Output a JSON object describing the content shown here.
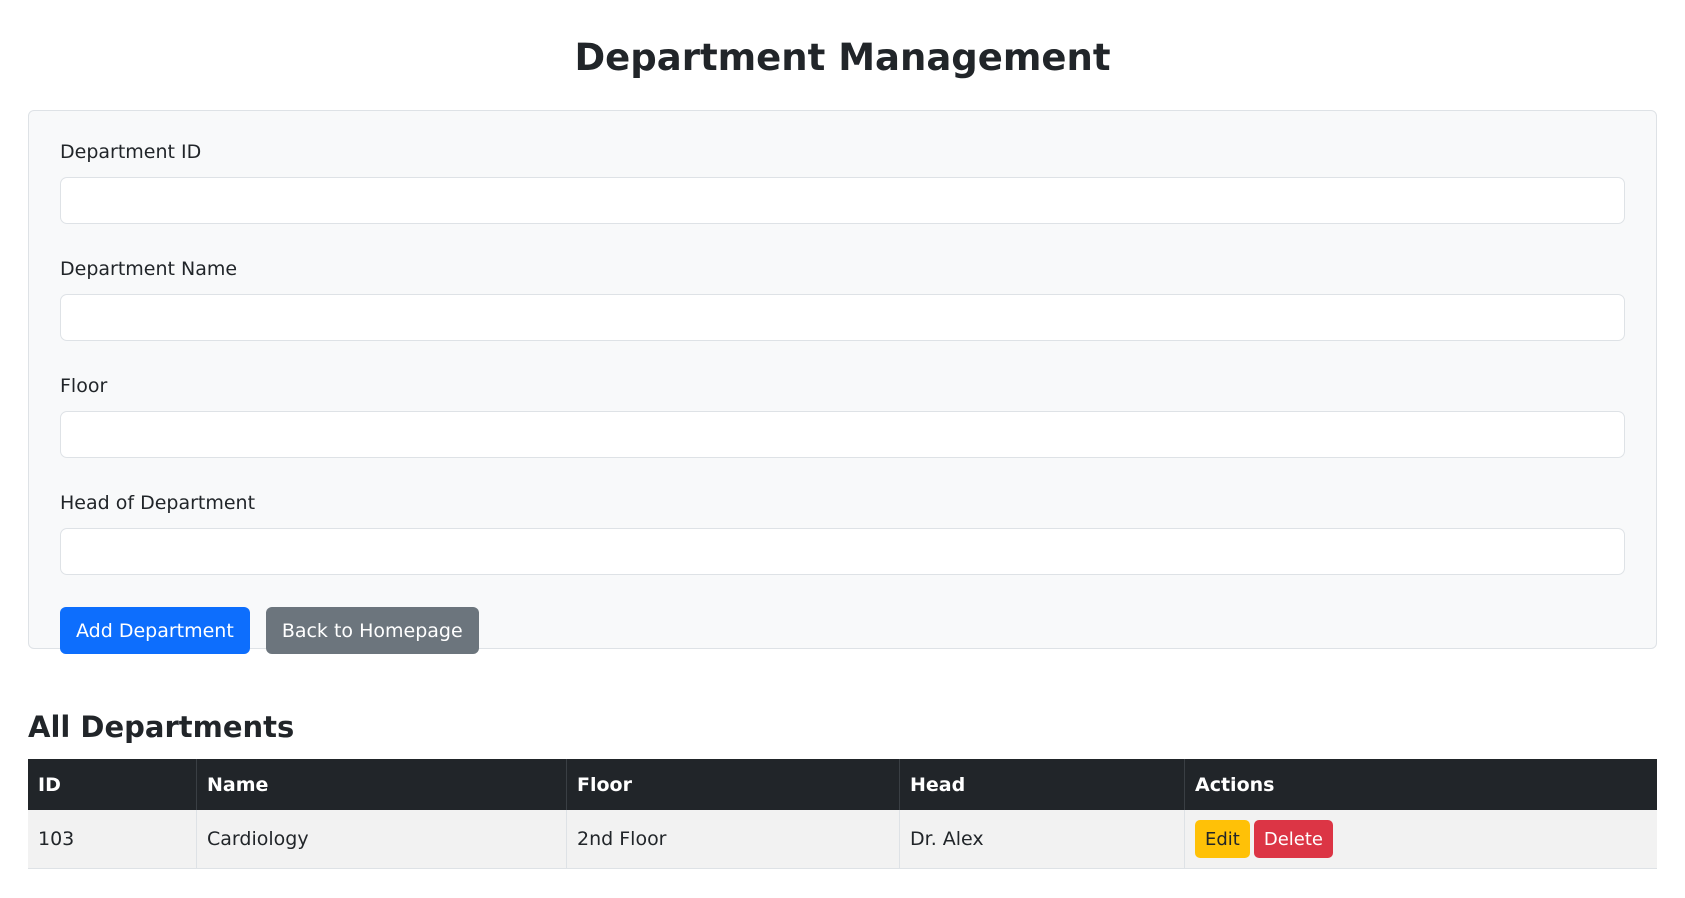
{
  "page": {
    "title": "Department Management"
  },
  "form": {
    "fields": [
      {
        "label": "Department ID",
        "value": "",
        "placeholder": ""
      },
      {
        "label": "Department Name",
        "value": "",
        "placeholder": ""
      },
      {
        "label": "Floor",
        "value": "",
        "placeholder": ""
      },
      {
        "label": "Head of Department",
        "value": "",
        "placeholder": ""
      }
    ],
    "add_button_label": "Add Department",
    "back_button_label": "Back to Homepage"
  },
  "departments": {
    "title": "All Departments",
    "columns": [
      "ID",
      "Name",
      "Floor",
      "Head",
      "Actions"
    ],
    "rows": [
      {
        "id": "103",
        "name": "Cardiology",
        "floor": "2nd Floor",
        "head": "Dr. Alex",
        "edit_label": "Edit",
        "delete_label": "Delete"
      }
    ]
  },
  "colors": {
    "primary": "#0d6efd",
    "secondary": "#6c757d",
    "warning": "#ffc107",
    "danger": "#dc3545",
    "table_header": "#212529"
  }
}
